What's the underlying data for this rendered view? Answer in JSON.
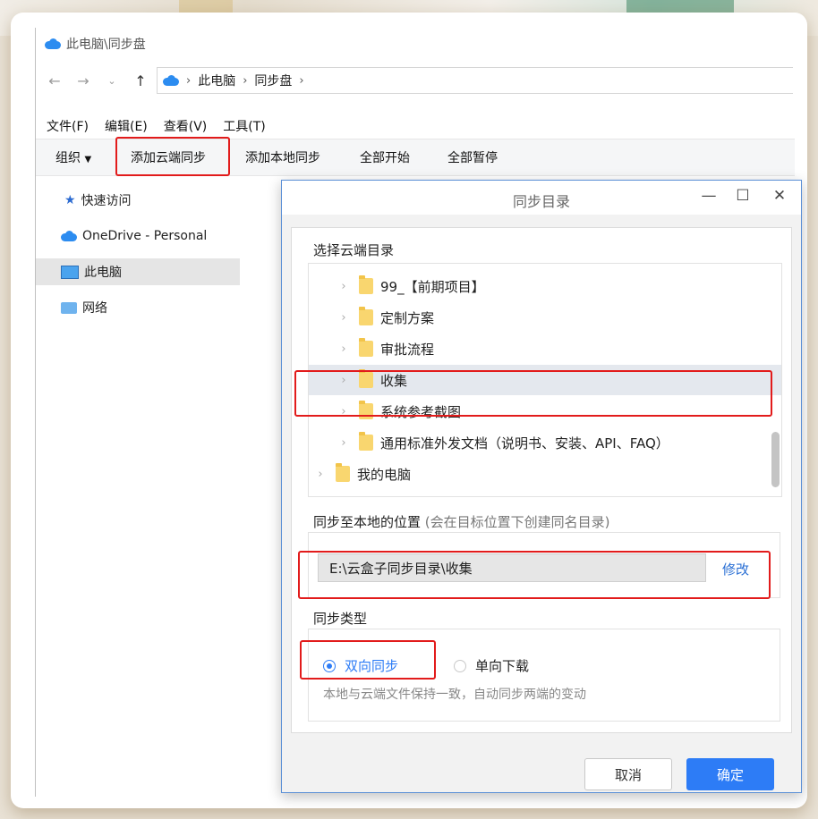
{
  "window": {
    "title": "此电脑\\同步盘"
  },
  "address_bar": {
    "crumbs": [
      "此电脑",
      "同步盘"
    ]
  },
  "menu": [
    "文件(F)",
    "编辑(E)",
    "查看(V)",
    "工具(T)"
  ],
  "commands": {
    "organize": "组织",
    "add_cloud": "添加云端同步",
    "add_local": "添加本地同步",
    "start_all": "全部开始",
    "pause_all": "全部暂停"
  },
  "sidebar": {
    "items": [
      {
        "label": "快速访问"
      },
      {
        "label": "OneDrive - Personal"
      },
      {
        "label": "此电脑"
      },
      {
        "label": "网络"
      }
    ]
  },
  "dialog": {
    "title": "同步目录",
    "section_cloud": "选择云端目录",
    "tree": [
      {
        "label": "99_【前期项目】"
      },
      {
        "label": "定制方案"
      },
      {
        "label": "审批流程"
      },
      {
        "label": "收集",
        "selected": true
      },
      {
        "label": "系统参考截图"
      },
      {
        "label": "通用标准外发文档（说明书、安装、API、FAQ）"
      },
      {
        "label": "我的电脑"
      }
    ],
    "section_local": "同步至本地的位置",
    "section_local_hint": "(会在目标位置下创建同名目录)",
    "local_path": "E:\\云盒子同步目录\\收集",
    "modify_label": "修改",
    "section_type": "同步类型",
    "type_two_way": "双向同步",
    "type_one_way": "单向下载",
    "type_desc": "本地与云端文件保持一致，自动同步两端的变动",
    "cancel_label": "取消",
    "ok_label": "确定"
  },
  "colors": {
    "accent": "#2d7cf6",
    "highlight": "#e21b1b",
    "folder": "#f9d66f"
  }
}
